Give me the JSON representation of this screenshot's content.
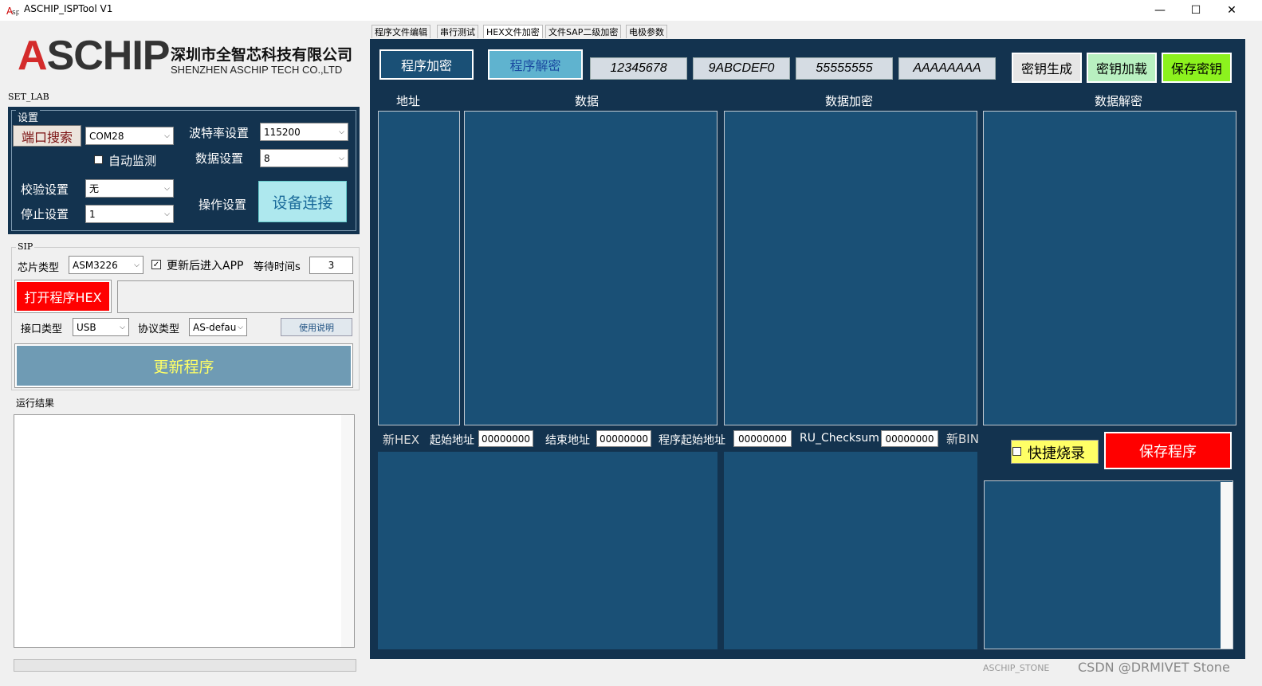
{
  "window": {
    "title": "ASCHIP_ISPTool V1",
    "minimize": "—",
    "maximize": "☐",
    "close": "✕"
  },
  "logo": {
    "text_a": "A",
    "text_rest": "SCHIP",
    "company_cn": "深圳市全智芯科技有限公司",
    "company_en": "SHENZHEN ASCHIP TECH CO.,LTD"
  },
  "set_lab": "SET_LAB",
  "settings": {
    "group_title": "设置",
    "port_search": "端口搜索",
    "port_value": "COM28",
    "baud_label": "波特率设置",
    "baud_value": "115200",
    "auto_monitor": "自动监测",
    "data_label": "数据设置",
    "data_value": "8",
    "parity_label": "校验设置",
    "parity_value": "无",
    "stop_label": "停止设置",
    "stop_value": "1",
    "op_label": "操作设置",
    "connect": "设备连接"
  },
  "sip": {
    "title": "SIP",
    "chip_label": "芯片类型",
    "chip_value": "ASM3226",
    "enter_app": "更新后进入APP",
    "wait_label": "等待时间s",
    "wait_value": "3",
    "open_hex": "打开程序HEX",
    "iface_label": "接口类型",
    "iface_value": "USB",
    "proto_label": "协议类型",
    "proto_value": "AS-defau",
    "usage": "使用说明",
    "update": "更新程序"
  },
  "result": {
    "title": "运行结果"
  },
  "tabs": [
    "程序文件编辑",
    "串行测试",
    "HEX文件加密",
    "文件SAP二级加密",
    "电极参数"
  ],
  "crypto": {
    "encrypt_btn": "程序加密",
    "decrypt_btn": "程序解密",
    "keys": [
      "12345678",
      "9ABCDEF0",
      "55555555",
      "AAAAAAAA"
    ],
    "key_gen": "密钥生成",
    "key_load": "密钥加载",
    "key_save": "保存密钥",
    "col_addr": "地址",
    "col_data": "数据",
    "col_enc": "数据加密",
    "col_dec": "数据解密",
    "new_hex": "新HEX",
    "start_addr_label": "起始地址",
    "start_addr": "00000000",
    "end_addr_label": "结束地址",
    "end_addr": "00000000",
    "prog_start_label": "程序起始地址",
    "prog_start": "00000000",
    "checksum_label": "RU_Checksum",
    "checksum": "00000000",
    "new_bin": "新BIN",
    "quick_burn": "快捷烧录",
    "save_prog": "保存程序"
  },
  "footer": {
    "stone": "ASCHIP_STONE",
    "watermark": "CSDN @DRMIVET Stone"
  },
  "colors": {
    "panel": "#13334f",
    "field": "#1a5076",
    "red": "#ff0000",
    "connect": "#aee8ee",
    "update": "#6f9bb4",
    "yellow": "#ffff66",
    "lime": "#8cf21e"
  }
}
